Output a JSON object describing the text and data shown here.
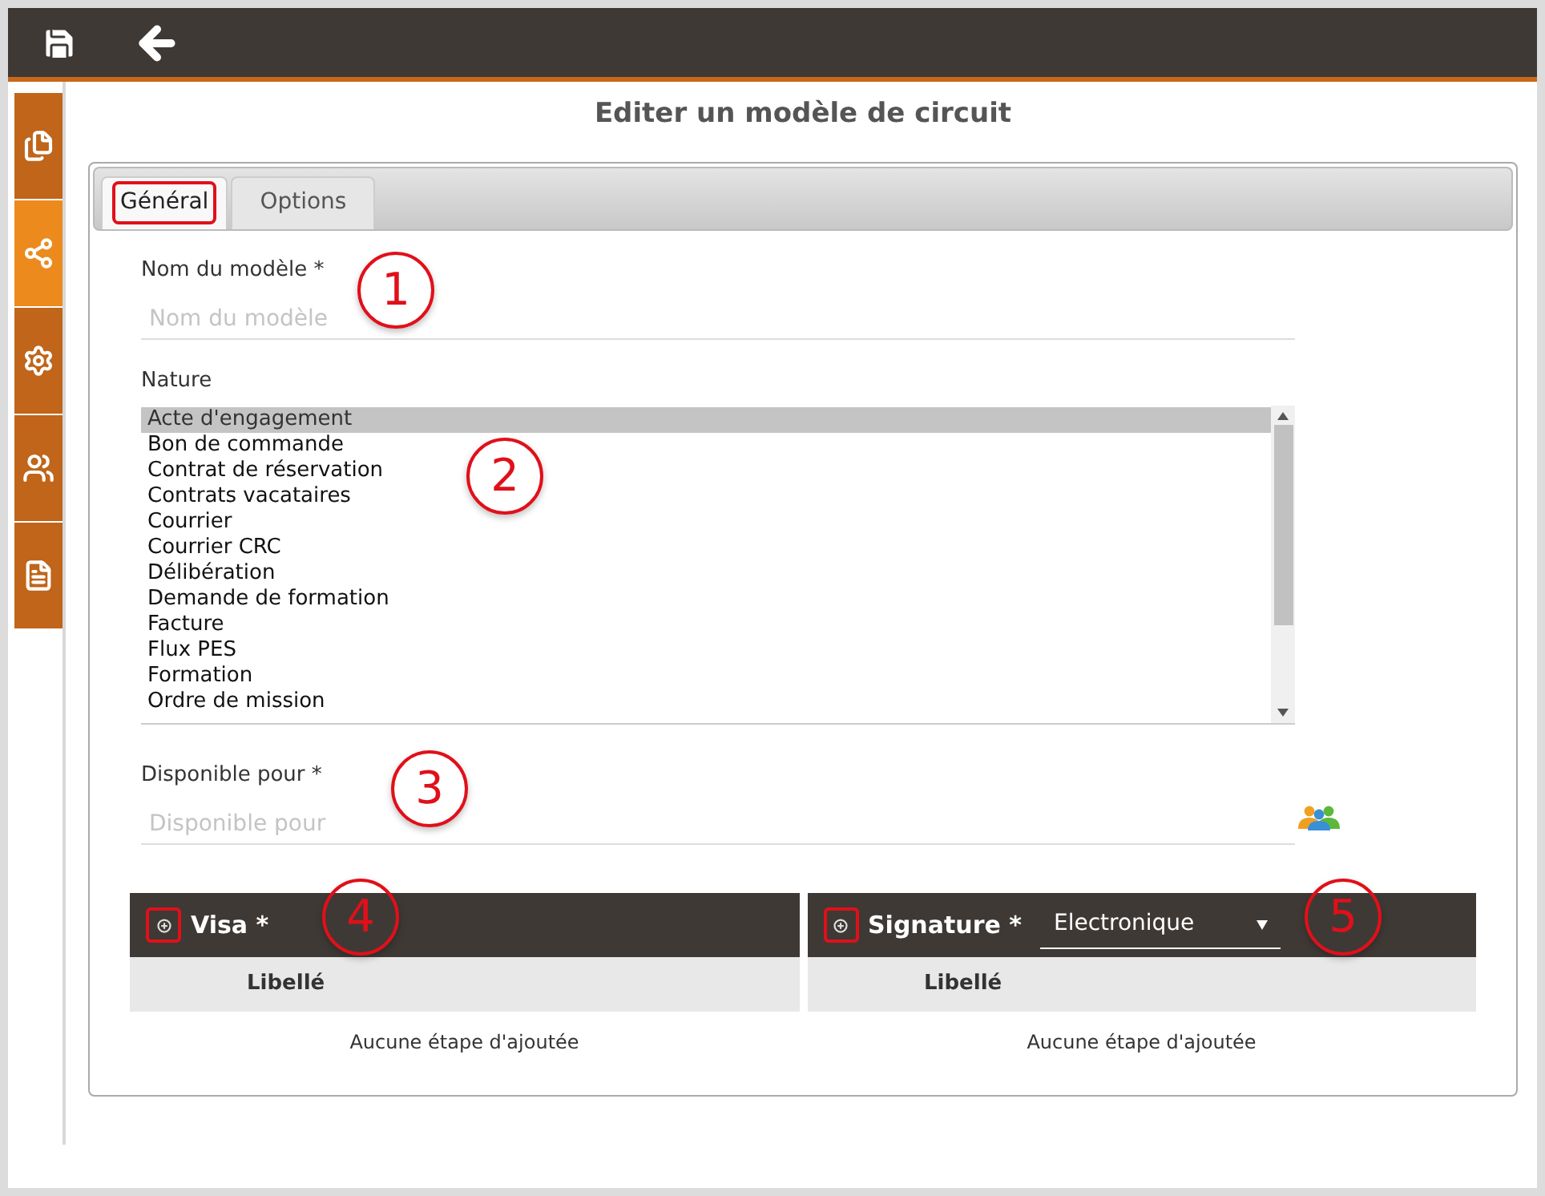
{
  "toolbar": {
    "buttons": [
      {
        "kind": "save"
      },
      {
        "kind": "back"
      }
    ]
  },
  "sidebar": {
    "items": [
      {
        "kind": "documents",
        "selected": false
      },
      {
        "kind": "share",
        "selected": true
      },
      {
        "kind": "settings",
        "selected": false
      },
      {
        "kind": "users",
        "selected": false
      },
      {
        "kind": "file",
        "selected": false
      }
    ]
  },
  "title": "Editer un modèle de circuit",
  "tabs": [
    {
      "label": "Général",
      "selected": true,
      "highlighted": true
    },
    {
      "label": "Options",
      "selected": false,
      "highlighted": false
    }
  ],
  "name_field": {
    "label": "Nom du modèle *",
    "placeholder": "Nom du modèle"
  },
  "nature": {
    "label": "Nature",
    "items": [
      {
        "label": "Acte d'engagement",
        "selected": true
      },
      {
        "label": "Bon de commande",
        "selected": false
      },
      {
        "label": "Contrat de réservation",
        "selected": false
      },
      {
        "label": "Contrats vacataires",
        "selected": false
      },
      {
        "label": "Courrier",
        "selected": false
      },
      {
        "label": "Courrier CRC",
        "selected": false
      },
      {
        "label": "Délibération",
        "selected": false
      },
      {
        "label": "Demande de formation",
        "selected": false
      },
      {
        "label": "Facture",
        "selected": false
      },
      {
        "label": "Flux PES",
        "selected": false
      },
      {
        "label": "Formation",
        "selected": false
      },
      {
        "label": "Ordre de mission",
        "selected": false
      }
    ]
  },
  "available_field": {
    "label": "Disponible pour *",
    "placeholder": "Disponible pour"
  },
  "sections": [
    {
      "title": "Visa *",
      "plus_highlighted": true,
      "column": "Libellé",
      "empty_text": "Aucune étape d'ajoutée"
    },
    {
      "title": "Signature *",
      "plus_highlighted": true,
      "select": "Electronique",
      "column": "Libellé",
      "empty_text": "Aucune étape d'ajoutée"
    }
  ],
  "callouts": [
    {
      "number": "1"
    },
    {
      "number": "2"
    },
    {
      "number": "3"
    },
    {
      "number": "4"
    },
    {
      "number": "5"
    }
  ]
}
